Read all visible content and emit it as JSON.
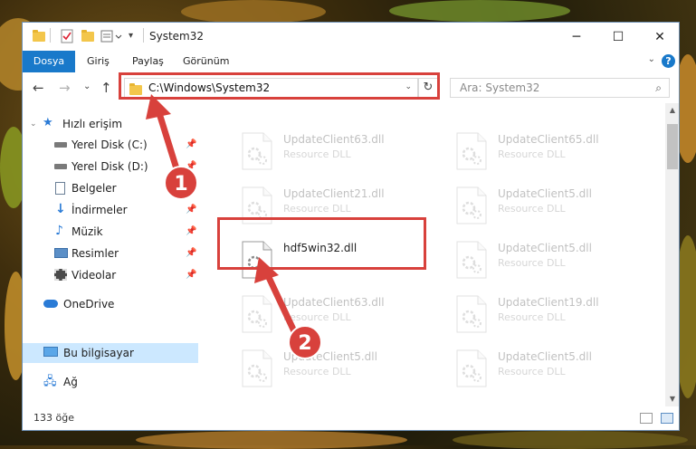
{
  "window": {
    "title": "System32",
    "minimize": "─",
    "maximize": "☐",
    "close": "✕"
  },
  "ribbon": {
    "tabs": [
      "Dosya",
      "Giriş",
      "Paylaş",
      "Görünüm"
    ],
    "help": "?"
  },
  "nav": {
    "back": "←",
    "forward": "→",
    "recent": "⌄",
    "up": "↑",
    "address": "C:\\Windows\\System32",
    "search_placeholder": "Ara: System32"
  },
  "sidebar": {
    "items": [
      {
        "label": "Hızlı erişim",
        "icon": "star-icon",
        "pinned": false
      },
      {
        "label": "Yerel Disk (C:)",
        "icon": "drive-icon",
        "pinned": true
      },
      {
        "label": "Yerel Disk (D:)",
        "icon": "drive-icon",
        "pinned": true
      },
      {
        "label": "Belgeler",
        "icon": "document-icon",
        "pinned": true
      },
      {
        "label": "İndirmeler",
        "icon": "download-icon",
        "pinned": true
      },
      {
        "label": "Müzik",
        "icon": "music-icon",
        "pinned": true
      },
      {
        "label": "Resimler",
        "icon": "pictures-icon",
        "pinned": true
      },
      {
        "label": "Videolar",
        "icon": "video-icon",
        "pinned": true
      },
      {
        "label": "OneDrive",
        "icon": "cloud-icon",
        "pinned": false
      },
      {
        "label": "Bu bilgisayar",
        "icon": "computer-icon",
        "pinned": false
      },
      {
        "label": "Ağ",
        "icon": "network-icon",
        "pinned": false
      }
    ]
  },
  "files": [
    {
      "name": "UpdateClient63.dll",
      "type": "Resource DLL",
      "faded": true
    },
    {
      "name": "UpdateClient65.dll",
      "type": "Resource DLL",
      "faded": true
    },
    {
      "name": "UpdateClient21.dll",
      "type": "Resource DLL",
      "faded": true
    },
    {
      "name": "UpdateClient5.dll",
      "type": "Resource DLL",
      "faded": true
    },
    {
      "name": "hdf5win32.dll",
      "type": "",
      "faded": false
    },
    {
      "name": "UpdateClient5.dll",
      "type": "Resource DLL",
      "faded": true
    },
    {
      "name": "UpdateClient63.dll",
      "type": "Resource DLL",
      "faded": true
    },
    {
      "name": "UpdateClient19.dll",
      "type": "Resource DLL",
      "faded": true
    },
    {
      "name": "UpdateClient5.dll",
      "type": "Resource DLL",
      "faded": true
    },
    {
      "name": "UpdateClient5.dll",
      "type": "Resource DLL",
      "faded": true
    }
  ],
  "status": {
    "count": "133 öğe"
  },
  "annotations": {
    "step1": "1",
    "step2": "2",
    "color": "#d8413c"
  }
}
